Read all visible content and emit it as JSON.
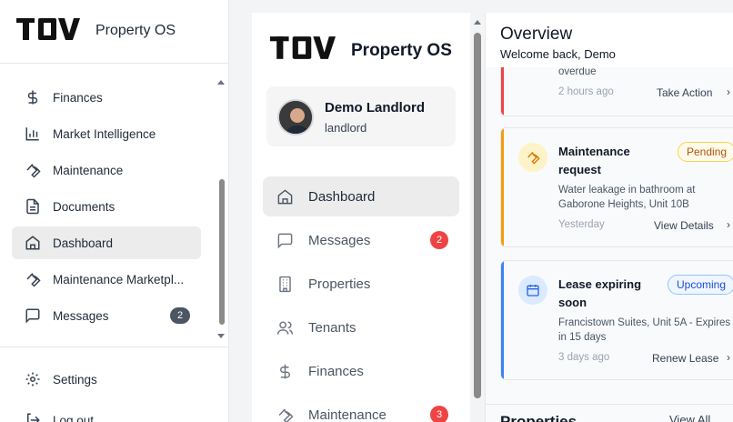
{
  "brand": {
    "name": "Property OS",
    "logo_text": "TOV"
  },
  "left_sidebar": {
    "items": [
      {
        "label": "Finances",
        "icon": "dollar-icon"
      },
      {
        "label": "Market Intelligence",
        "icon": "bar-chart-icon"
      },
      {
        "label": "Maintenance",
        "icon": "wrench-icon"
      },
      {
        "label": "Documents",
        "icon": "document-icon"
      },
      {
        "label": "Dashboard",
        "icon": "home-icon",
        "active": true
      },
      {
        "label": "Maintenance Marketpl...",
        "icon": "wrench-icon"
      },
      {
        "label": "Messages",
        "icon": "message-icon",
        "badge": "2"
      }
    ],
    "footer": [
      {
        "label": "Settings",
        "icon": "gear-icon"
      },
      {
        "label": "Log out",
        "icon": "logout-icon"
      }
    ]
  },
  "mid_panel": {
    "title": "Property OS",
    "profile": {
      "name": "Demo Landlord",
      "role": "landlord"
    },
    "nav": [
      {
        "label": "Dashboard",
        "icon": "home-icon",
        "active": true
      },
      {
        "label": "Messages",
        "icon": "message-icon",
        "badge": "2"
      },
      {
        "label": "Properties",
        "icon": "building-icon"
      },
      {
        "label": "Tenants",
        "icon": "users-icon"
      },
      {
        "label": "Finances",
        "icon": "dollar-icon"
      },
      {
        "label": "Maintenance",
        "icon": "wrench-icon",
        "badge": "3"
      }
    ]
  },
  "content": {
    "title": "Overview",
    "subtitle": "Welcome back, Demo",
    "cards": [
      {
        "partial_text": "overdue",
        "time": "2 hours ago",
        "action": "Take Action",
        "accent": "#ef4444"
      },
      {
        "title": "Maintenance request",
        "badge": "Pending",
        "desc": "Water leakage in bathroom at Gaborone Heights, Unit 10B",
        "time": "Yesterday",
        "action": "View Details",
        "accent": "#f59e0b"
      },
      {
        "title": "Lease expiring soon",
        "badge": "Upcoming",
        "desc": "Francistown Suites, Unit 5A - Expires in 15 days",
        "time": "3 days ago",
        "action": "Renew Lease",
        "accent": "#3b82f6"
      }
    ],
    "section_title": "Properties",
    "view_all": "View All"
  }
}
